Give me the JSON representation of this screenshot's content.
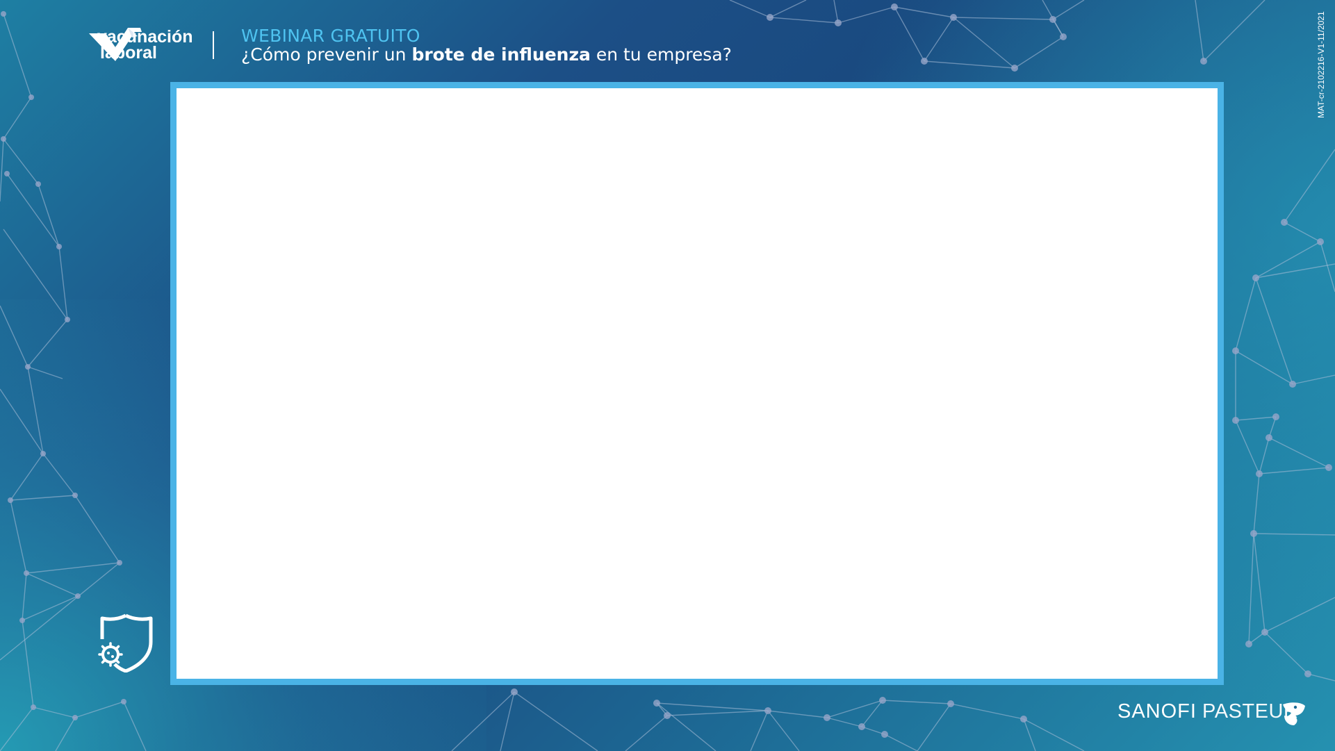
{
  "header": {
    "logo": {
      "name": "vacunacion-laboral-logo",
      "line1": "vacunación",
      "line2": "laboral"
    },
    "kicker": "WEBINAR GRATUITO",
    "title_prefix": "¿Cómo prevenir un ",
    "title_bold": "brote de influenza",
    "title_suffix": " en tu empresa?"
  },
  "video": {
    "frame_color": "#4ab3e6",
    "fill": "#ffffff"
  },
  "side_code": "MAT-cr-2102216-V1-11/2021",
  "brand": {
    "word1": "SANOFI",
    "word2": "PASTEUR",
    "icon": "sanofi-bird-icon"
  },
  "icons": {
    "shield": "virus-shield-icon"
  },
  "colors": {
    "accent": "#4fc3f0",
    "bg_dark": "#1a4a80",
    "bg_teal": "#2591b0"
  }
}
